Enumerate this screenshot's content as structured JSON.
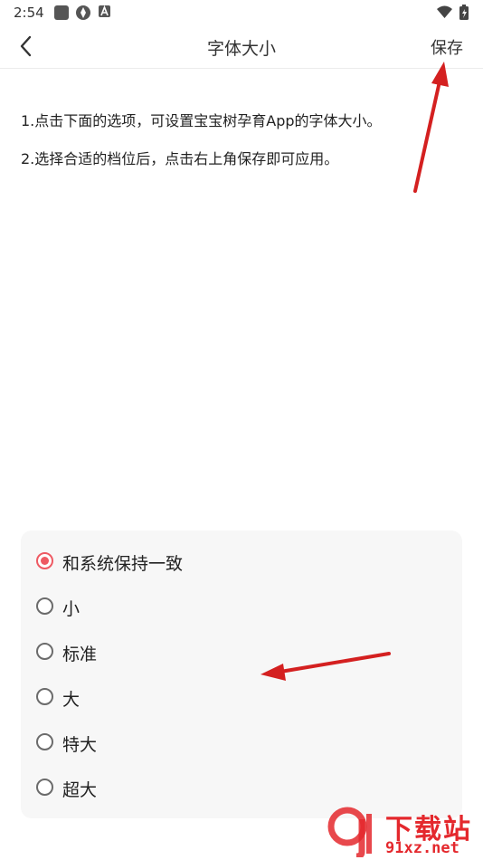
{
  "status_bar": {
    "time": "2:54"
  },
  "nav": {
    "title": "字体大小",
    "save_label": "保存"
  },
  "instructions": [
    "1.点击下面的选项，可设置宝宝树孕育App的字体大小。",
    "2.选择合适的档位后，点击右上角保存即可应用。"
  ],
  "options": [
    {
      "label": "和系统保持一致",
      "selected": true
    },
    {
      "label": "小",
      "selected": false
    },
    {
      "label": "标准",
      "selected": false
    },
    {
      "label": "大",
      "selected": false
    },
    {
      "label": "特大",
      "selected": false
    },
    {
      "label": "超大",
      "selected": false
    }
  ],
  "watermark": {
    "title": "下载站",
    "domain": "91xz.net"
  },
  "colors": {
    "accent": "#ee5a63",
    "annotation_arrow": "#d42020",
    "panel_bg": "#f7f7f7"
  }
}
